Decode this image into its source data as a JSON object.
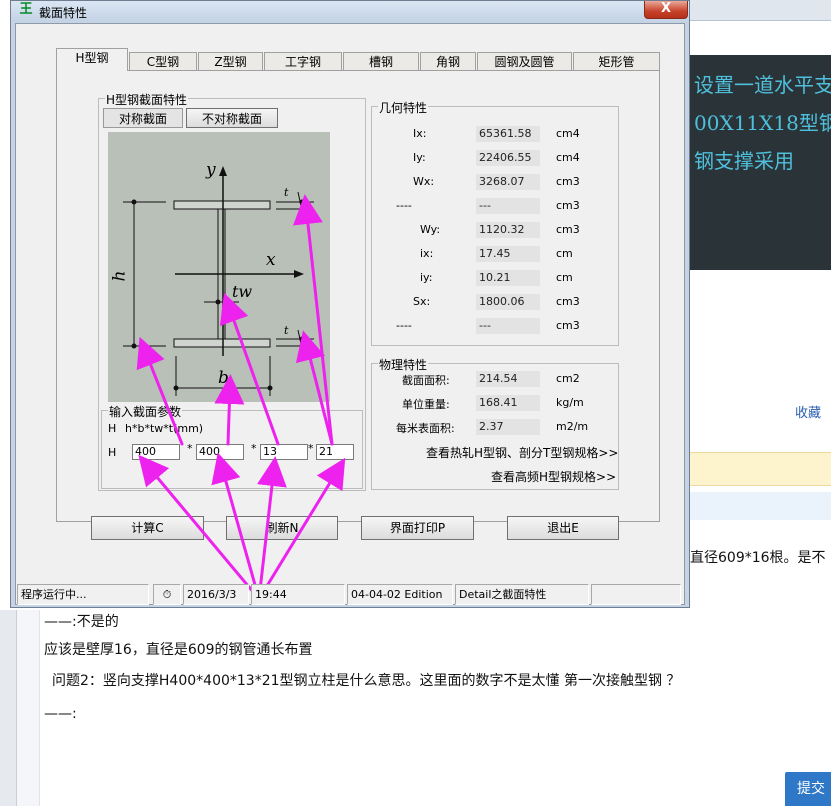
{
  "window": {
    "title": "截面特性",
    "close_label": "X"
  },
  "tabs": [
    {
      "label": "H型钢"
    },
    {
      "label": "C型钢"
    },
    {
      "label": "Z型钢"
    },
    {
      "label": "工字钢"
    },
    {
      "label": "槽钢"
    },
    {
      "label": "角钢"
    },
    {
      "label": "圆钢及圆管"
    },
    {
      "label": "矩形管"
    }
  ],
  "section_group": {
    "label": "H型钢截面特性",
    "symmetric_label": "对称截面",
    "asymmetric_label": "不对称截面"
  },
  "diagram": {
    "y": "y",
    "x": "x",
    "h": "h",
    "tw": "tw",
    "b": "b",
    "t": "t"
  },
  "input_group": {
    "label": "输入截面参数",
    "formula_prefix": "H",
    "formula": "h*b*tw*t(mm)",
    "row_label": "H",
    "h": "400",
    "b": "400",
    "tw": "13",
    "t": "21",
    "sep": "*"
  },
  "geom_group": {
    "label": "几何特性",
    "rows": [
      {
        "name": "Ix:",
        "value": "65361.58",
        "unit": "cm4"
      },
      {
        "name": "Iy:",
        "value": "22406.55",
        "unit": "cm4"
      },
      {
        "name": "Wx:",
        "value": "3268.07",
        "unit": "cm3"
      },
      {
        "name": "----",
        "value": "---",
        "unit": "cm3"
      },
      {
        "name": "Wy:",
        "value": "1120.32",
        "unit": "cm3"
      },
      {
        "name": "ix:",
        "value": "17.45",
        "unit": "cm"
      },
      {
        "name": "iy:",
        "value": "10.21",
        "unit": "cm"
      },
      {
        "name": "Sx:",
        "value": "1800.06",
        "unit": "cm3"
      },
      {
        "name": "----",
        "value": "---",
        "unit": "cm3"
      }
    ]
  },
  "phys_group": {
    "label": "物理特性",
    "rows": [
      {
        "name": "截面面积:",
        "value": "214.54",
        "unit": "cm2"
      },
      {
        "name": "单位重量:",
        "value": "168.41",
        "unit": "kg/m"
      },
      {
        "name": "每米表面积:",
        "value": "2.37",
        "unit": "m2/m"
      }
    ],
    "link1": "查看热轧H型钢、剖分T型钢规格>>",
    "link2": "查看高频H型钢规格>>"
  },
  "buttons": {
    "calc": "计算C",
    "refresh": "刷新N",
    "print": "界面打印P",
    "exit": "退出E"
  },
  "statusbar": {
    "status": "程序运行中...",
    "date": "2016/3/3",
    "time": "19:44",
    "edition": "04-04-02 Edition",
    "detail": "Detail之截面特性"
  },
  "background": {
    "dark_line1": "设置一道水平支",
    "dark_line2": "00X11X18型钢,",
    "dark_line3": "钢支撑采用",
    "collect": "收藏",
    "side_text": "直径609*16根。是不",
    "reply_prefix": "——:不是的",
    "answer": "应该是壁厚16，直径是609的钢管通长布置",
    "question": "问题2：竖向支撑H400*400*13*21型钢立柱是什么意思。这里面的数字不是太懂  第一次接触型钢 ？",
    "reply2": "——:",
    "submit": "提交"
  },
  "colors": {
    "annotation_arrow": "#ee22ee",
    "diagram_bg": "#b9c0b7"
  }
}
